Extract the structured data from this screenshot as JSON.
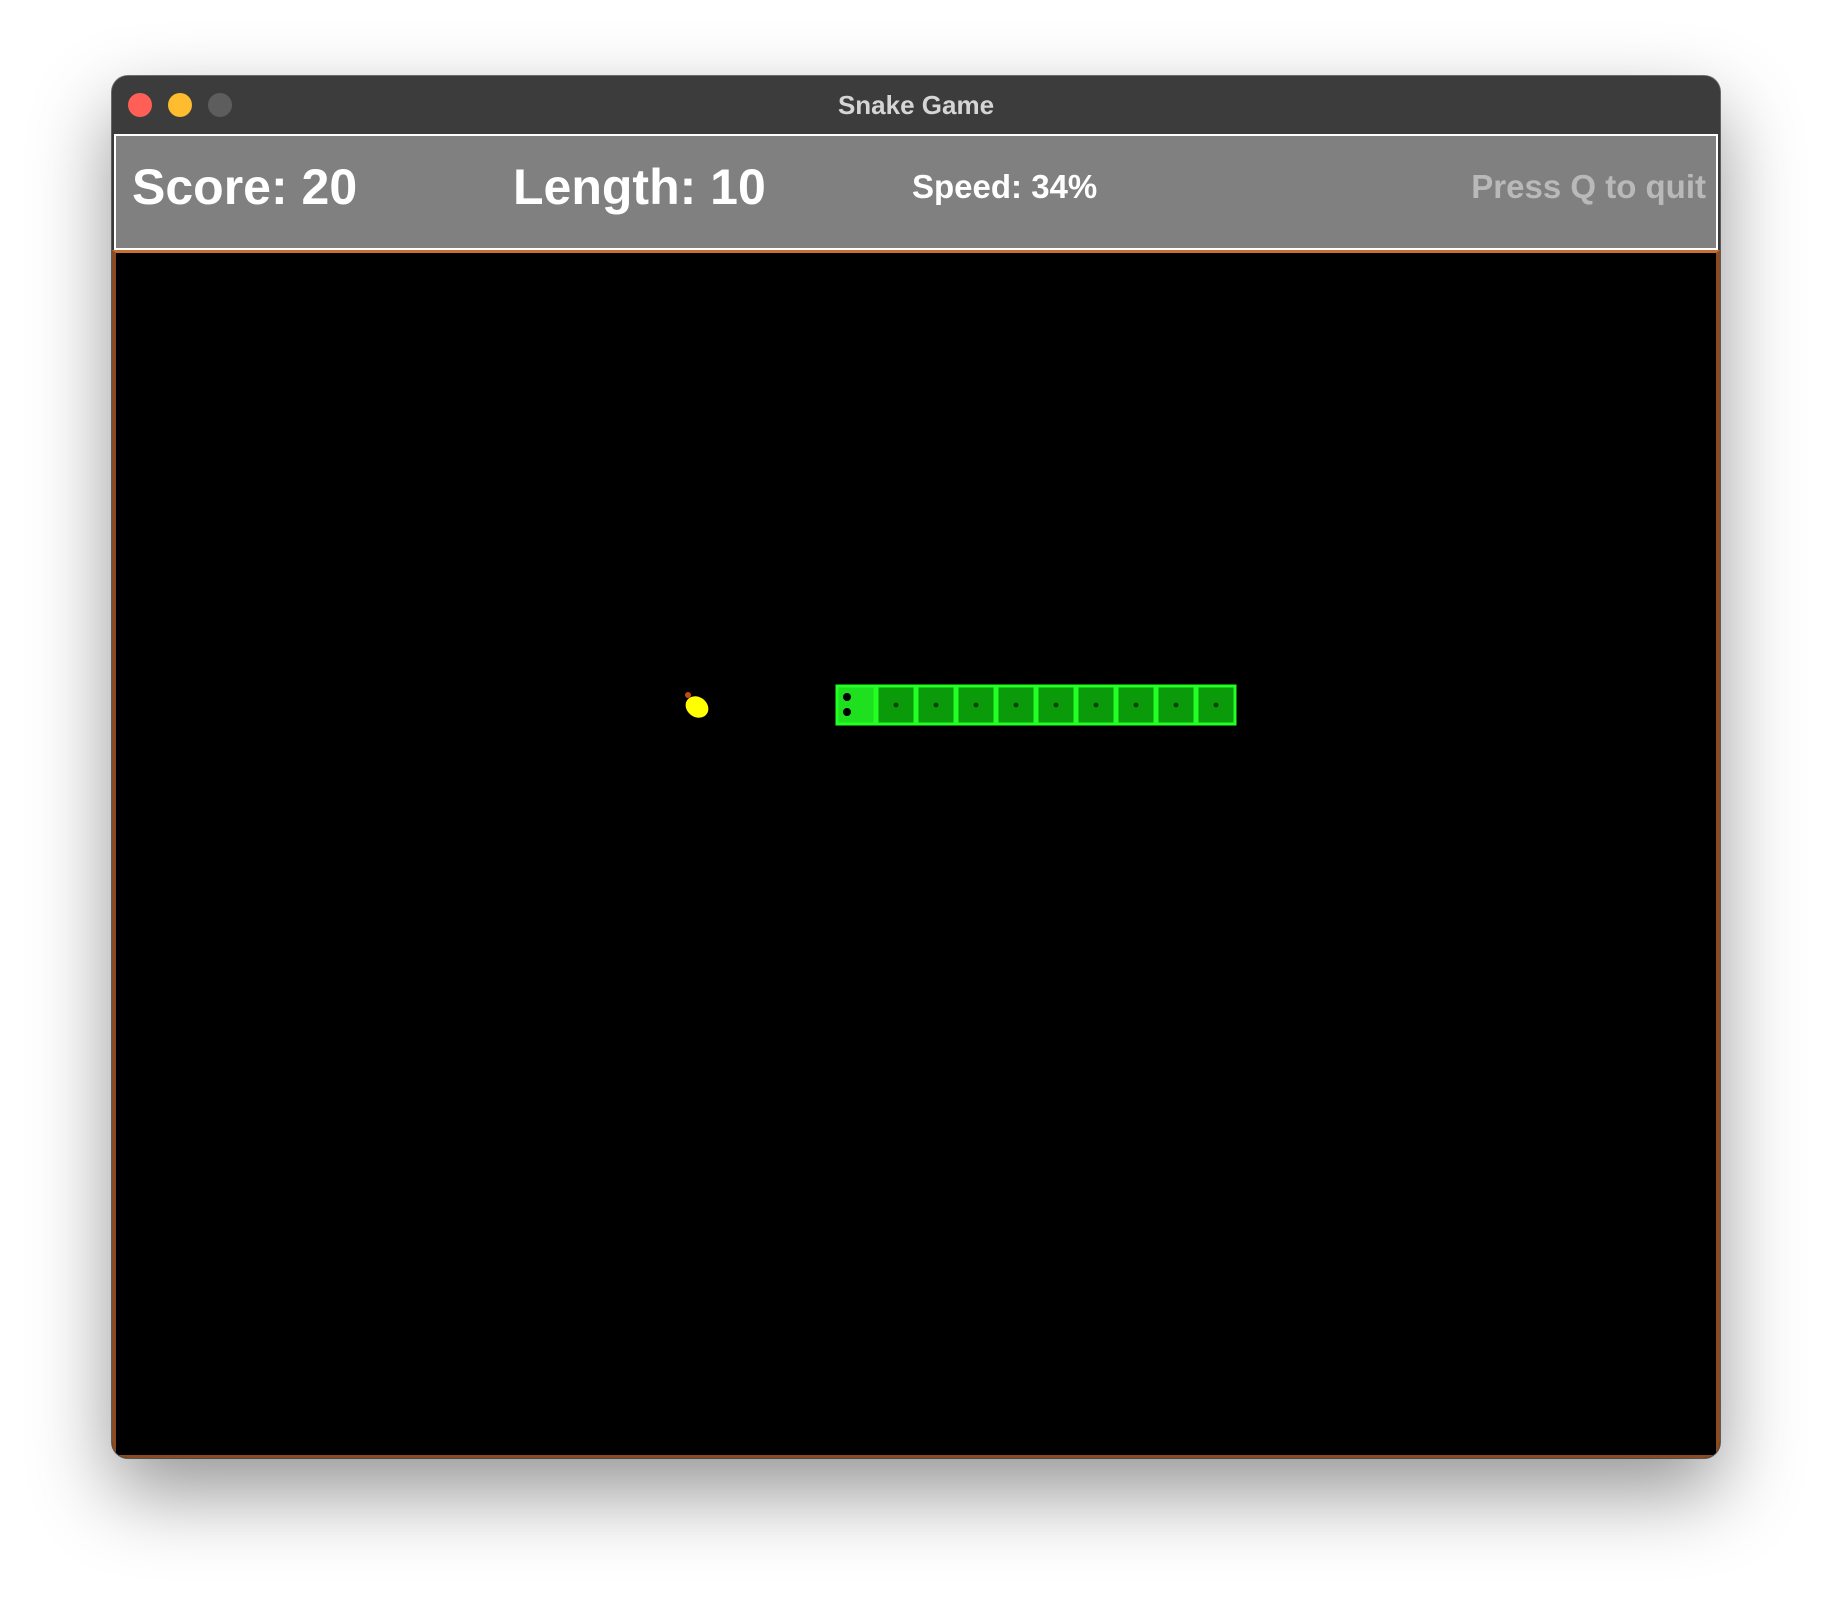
{
  "window": {
    "title": "Snake Game",
    "controls": {
      "close": "close-button",
      "minimize": "minimize-button",
      "zoom": "zoom-button"
    }
  },
  "hud": {
    "score": "Score: 20",
    "length": "Length: 10",
    "speed": "Speed: 34%",
    "quit_hint": "Press Q to quit"
  },
  "game": {
    "score": 20,
    "length": 10,
    "speed_percent": 34,
    "direction": "left",
    "snake_cells": [
      [
        18,
        11
      ],
      [
        19,
        11
      ],
      [
        20,
        11
      ],
      [
        21,
        11
      ],
      [
        22,
        11
      ],
      [
        23,
        11
      ],
      [
        24,
        11
      ],
      [
        25,
        11
      ],
      [
        26,
        11
      ],
      [
        27,
        11
      ]
    ],
    "food_cell": [
      14,
      11
    ],
    "food_icon": "lemon-icon",
    "colors": {
      "background": "#000000",
      "head": "#1fe01f",
      "body": "#0a9a0a",
      "border": "#22ff22",
      "food": "#ffff00",
      "eyes": "#000000"
    }
  }
}
